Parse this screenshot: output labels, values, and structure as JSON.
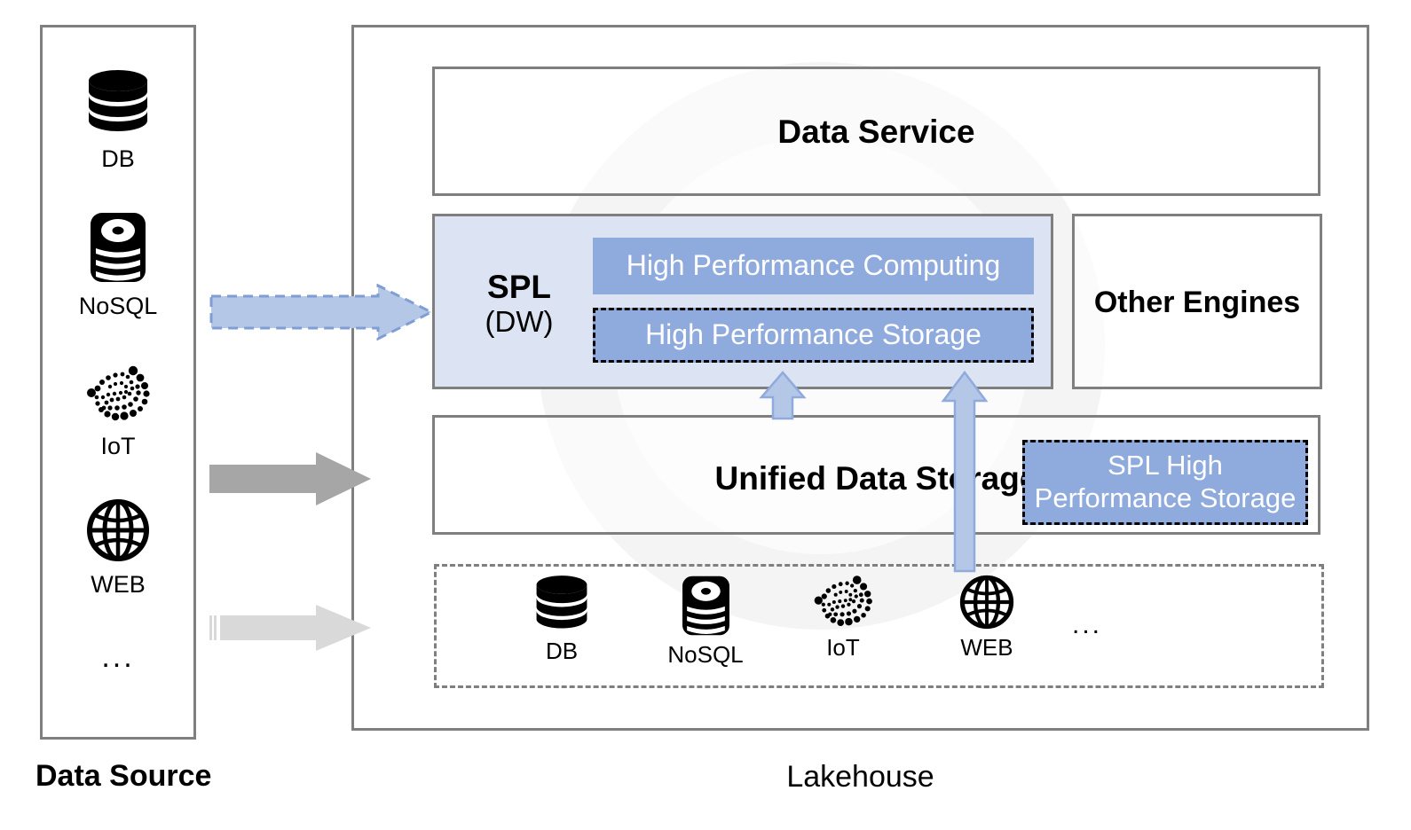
{
  "captions": {
    "data_source": "Data Source",
    "lakehouse": "Lakehouse"
  },
  "data_source": {
    "items": [
      {
        "icon": "database-icon",
        "label": "DB"
      },
      {
        "icon": "nosql-icon",
        "label": "NoSQL"
      },
      {
        "icon": "iot-icon",
        "label": "IoT"
      },
      {
        "icon": "web-globe-icon",
        "label": "WEB"
      }
    ],
    "ellipsis": "..."
  },
  "lakehouse": {
    "data_service": {
      "title": "Data Service"
    },
    "spl": {
      "name": "SPL",
      "subtitle": "(DW)",
      "boxes": [
        {
          "label": "High Performance Computing",
          "style": "solid"
        },
        {
          "label": "High Performance Storage",
          "style": "dashed"
        }
      ]
    },
    "other_engines": {
      "title": "Other Engines"
    },
    "unified_storage": {
      "title": "Unified Data Storage",
      "spl_storage_label": "SPL High\nPerformance Storage",
      "spl_storage_line1": "SPL High",
      "spl_storage_line2": "Performance Storage"
    },
    "sources_row": {
      "items": [
        {
          "icon": "database-icon",
          "label": "DB"
        },
        {
          "icon": "nosql-icon",
          "label": "NoSQL"
        },
        {
          "icon": "iot-icon",
          "label": "IoT"
        },
        {
          "icon": "web-globe-icon",
          "label": "WEB"
        }
      ],
      "ellipsis": "..."
    }
  },
  "arrows": [
    {
      "name": "arrow-nosql-to-spl",
      "direction": "right",
      "style": "dashed-blue"
    },
    {
      "name": "arrow-iot-to-unified",
      "direction": "right",
      "style": "solid-gray"
    },
    {
      "name": "arrow-web-to-sources",
      "direction": "right",
      "style": "light-gray"
    },
    {
      "name": "arrow-unified-to-spl",
      "direction": "up",
      "style": "blue-short"
    },
    {
      "name": "arrow-sources-to-spl",
      "direction": "up",
      "style": "blue-long"
    }
  ],
  "colors": {
    "blue_fill": "#8faadc",
    "blue_light": "#dce4f4",
    "arrow_blue": "#b4c7e7",
    "arrow_blue_border": "#8faadc",
    "border_gray": "#7f7f7f",
    "arrow_gray_dark": "#a6a6a6",
    "arrow_gray_light": "#d9d9d9",
    "watermark": "#f4f4f4"
  }
}
